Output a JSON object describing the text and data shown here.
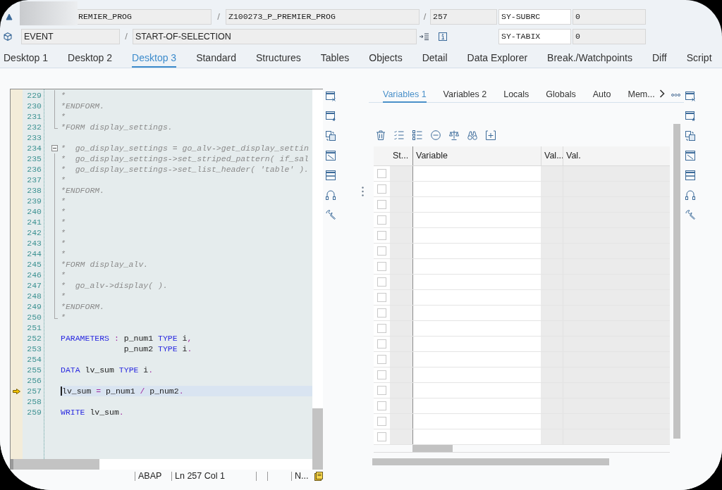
{
  "header": {
    "row_1": {
      "field_1": "REMIER_PROG",
      "separator_1": "/",
      "field_2": "Z100273_P_PREMIER_PROG",
      "separator_2": "/",
      "field_3": "257",
      "variable_name": "SY-SUBRC",
      "variable_value": "0"
    },
    "row_2": {
      "field_1": "EVENT",
      "separator": "/",
      "field_2": "START-OF-SELECTION",
      "variable_name": "SY-TABIX",
      "variable_value": "0"
    }
  },
  "desktop_tabs": [
    {
      "label": "Desktop 1",
      "selected": false
    },
    {
      "label": "Desktop 2",
      "selected": false
    },
    {
      "label": "Desktop 3",
      "selected": true
    },
    {
      "label": "Standard",
      "selected": false
    },
    {
      "label": "Structures",
      "selected": false
    },
    {
      "label": "Tables",
      "selected": false
    },
    {
      "label": "Objects",
      "selected": false
    },
    {
      "label": "Detail",
      "selected": false
    },
    {
      "label": "Data Explorer",
      "selected": false
    },
    {
      "label": "Break./Watchpoints",
      "selected": false
    },
    {
      "label": "Diff",
      "selected": false
    },
    {
      "label": "Script",
      "selected": false
    }
  ],
  "editor": {
    "lines": [
      {
        "number": "229",
        "kind": "inside",
        "current": false,
        "tokens": [
          {
            "kind": "comment",
            "text": "*"
          }
        ]
      },
      {
        "number": "230",
        "kind": "inside",
        "current": false,
        "tokens": [
          {
            "kind": "comment",
            "text": "*ENDFORM."
          }
        ]
      },
      {
        "number": "231",
        "kind": "inside",
        "current": false,
        "tokens": [
          {
            "kind": "comment",
            "text": "*"
          }
        ]
      },
      {
        "number": "232",
        "kind": "end",
        "current": false,
        "tokens": [
          {
            "kind": "comment",
            "text": "*FORM display_settings."
          }
        ]
      },
      {
        "number": "233",
        "kind": "plain",
        "current": false
      },
      {
        "number": "234",
        "kind": "start",
        "current": false,
        "tokens": [
          {
            "kind": "comment",
            "text": "*  go_display_settings = go_alv->get_display_settin"
          }
        ]
      },
      {
        "number": "235",
        "kind": "inside",
        "current": false,
        "tokens": [
          {
            "kind": "comment",
            "text": "*  go_display_settings->set_striped_pattern( if_sal"
          }
        ]
      },
      {
        "number": "236",
        "kind": "inside",
        "current": false,
        "tokens": [
          {
            "kind": "comment",
            "text": "*  go_display_settings->set_list_header( 'table' )."
          }
        ]
      },
      {
        "number": "237",
        "kind": "inside",
        "current": false,
        "tokens": [
          {
            "kind": "comment",
            "text": "*"
          }
        ]
      },
      {
        "number": "238",
        "kind": "inside",
        "current": false,
        "tokens": [
          {
            "kind": "comment",
            "text": "*ENDFORM."
          }
        ]
      },
      {
        "number": "239",
        "kind": "inside",
        "current": false,
        "tokens": [
          {
            "kind": "comment",
            "text": "*"
          }
        ]
      },
      {
        "number": "240",
        "kind": "inside",
        "current": false,
        "tokens": [
          {
            "kind": "comment",
            "text": "*"
          }
        ]
      },
      {
        "number": "241",
        "kind": "inside",
        "current": false,
        "tokens": [
          {
            "kind": "comment",
            "text": "*"
          }
        ]
      },
      {
        "number": "242",
        "kind": "inside",
        "current": false,
        "tokens": [
          {
            "kind": "comment",
            "text": "*"
          }
        ]
      },
      {
        "number": "243",
        "kind": "inside",
        "current": false,
        "tokens": [
          {
            "kind": "comment",
            "text": "*"
          }
        ]
      },
      {
        "number": "244",
        "kind": "inside",
        "current": false,
        "tokens": [
          {
            "kind": "comment",
            "text": "*"
          }
        ]
      },
      {
        "number": "245",
        "kind": "inside",
        "current": false,
        "tokens": [
          {
            "kind": "comment",
            "text": "*FORM display_alv."
          }
        ]
      },
      {
        "number": "246",
        "kind": "inside",
        "current": false,
        "tokens": [
          {
            "kind": "comment",
            "text": "*"
          }
        ]
      },
      {
        "number": "247",
        "kind": "inside",
        "current": false,
        "tokens": [
          {
            "kind": "comment",
            "text": "*  go_alv->display( )."
          }
        ]
      },
      {
        "number": "248",
        "kind": "inside",
        "current": false,
        "tokens": [
          {
            "kind": "comment",
            "text": "*"
          }
        ]
      },
      {
        "number": "249",
        "kind": "inside",
        "current": false,
        "tokens": [
          {
            "kind": "comment",
            "text": "*ENDFORM."
          }
        ]
      },
      {
        "number": "250",
        "kind": "end",
        "current": false,
        "tokens": [
          {
            "kind": "comment",
            "text": "*"
          }
        ]
      },
      {
        "number": "251",
        "kind": "plain",
        "current": false
      },
      {
        "number": "252",
        "kind": "plain",
        "current": false,
        "tokens": [
          {
            "kind": "keyword",
            "text": "PARAMETERS"
          },
          {
            "kind": "operator",
            "text": " :"
          },
          {
            "kind": "identifier",
            "text": " p_num1 "
          },
          {
            "kind": "keyword",
            "text": "TYPE"
          },
          {
            "kind": "identifier",
            "text": " i"
          },
          {
            "kind": "operator",
            "text": ","
          }
        ]
      },
      {
        "number": "253",
        "kind": "plain",
        "current": false,
        "tokens": [
          {
            "kind": "identifier",
            "text": "             p_num2 "
          },
          {
            "kind": "keyword",
            "text": "TYPE"
          },
          {
            "kind": "identifier",
            "text": " i"
          },
          {
            "kind": "operator",
            "text": "."
          }
        ]
      },
      {
        "number": "254",
        "kind": "plain",
        "current": false
      },
      {
        "number": "255",
        "kind": "plain",
        "current": false,
        "tokens": [
          {
            "kind": "keyword",
            "text": "DATA"
          },
          {
            "kind": "identifier",
            "text": " lv_sum "
          },
          {
            "kind": "keyword",
            "text": "TYPE"
          },
          {
            "kind": "identifier",
            "text": " i"
          },
          {
            "kind": "operator",
            "text": "."
          }
        ]
      },
      {
        "number": "256",
        "kind": "plain",
        "current": false
      },
      {
        "number": "257",
        "kind": "plain",
        "current": true,
        "tokens": [
          {
            "kind": "identifier",
            "text": "lv_sum "
          },
          {
            "kind": "operator",
            "text": "="
          },
          {
            "kind": "identifier",
            "text": " p_num1 "
          },
          {
            "kind": "operator",
            "text": "/"
          },
          {
            "kind": "identifier",
            "text": " p_num2"
          },
          {
            "kind": "operator",
            "text": "."
          }
        ]
      },
      {
        "number": "258",
        "kind": "plain",
        "current": false
      },
      {
        "number": "259",
        "kind": "plain",
        "current": false,
        "tokens": [
          {
            "kind": "keyword",
            "text": "WRITE"
          },
          {
            "kind": "identifier",
            "text": " lv_sum"
          },
          {
            "kind": "operator",
            "text": "."
          }
        ]
      }
    ],
    "status_bar": [
      {
        "kind": "text",
        "text": "ABAP"
      },
      {
        "kind": "text",
        "text": "Ln 257 Col 1"
      },
      {
        "kind": "blank"
      },
      {
        "kind": "blank"
      },
      {
        "kind": "text",
        "text": "N..."
      }
    ]
  },
  "variables_panel": {
    "tabs": [
      {
        "label": "Variables 1",
        "selected": true
      },
      {
        "label": "Variables 2",
        "selected": false
      },
      {
        "label": "Locals",
        "selected": false
      },
      {
        "label": "Globals",
        "selected": false
      },
      {
        "label": "Auto",
        "selected": false
      },
      {
        "label": "Mem...",
        "selected": false
      }
    ],
    "table": {
      "columns": [
        {
          "label": "St..."
        },
        {
          "label": "Variable"
        },
        {
          "label": "Val..."
        },
        {
          "label": "Val."
        }
      ],
      "rows": [
        {
          "checked": false
        },
        {
          "checked": false
        },
        {
          "checked": false
        },
        {
          "checked": false
        },
        {
          "checked": false
        },
        {
          "checked": false
        },
        {
          "checked": false
        },
        {
          "checked": false
        },
        {
          "checked": false
        },
        {
          "checked": false
        },
        {
          "checked": false
        },
        {
          "checked": false
        },
        {
          "checked": false
        },
        {
          "checked": false
        },
        {
          "checked": false
        },
        {
          "checked": false
        },
        {
          "checked": false
        },
        {
          "checked": false
        }
      ]
    }
  }
}
